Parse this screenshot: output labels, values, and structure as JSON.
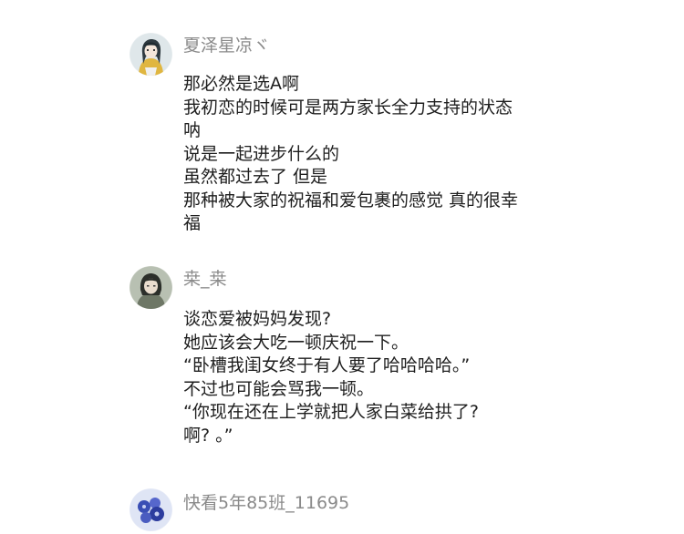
{
  "comments": [
    {
      "username": "夏泽星凉ヾ",
      "lines": [
        "那必然是选A啊",
        "我初恋的时候可是两方家长全力支持的状态",
        "呐",
        "说是一起进步什么的",
        "虽然都过去了 但是",
        "那种被大家的祝福和爱包裹的感觉 真的很幸",
        "福"
      ]
    },
    {
      "username": "桒_桒",
      "lines": [
        "谈恋爱被妈妈发现?",
        "她应该会大吃一顿庆祝一下。",
        "“卧槽我闺女终于有人要了哈哈哈哈。”",
        "不过也可能会骂我一顿。",
        "“你现在还在上学就把人家白菜给拱了?",
        "啊? 。”"
      ]
    },
    {
      "username": "快看5年85班_11695",
      "lines": []
    }
  ]
}
